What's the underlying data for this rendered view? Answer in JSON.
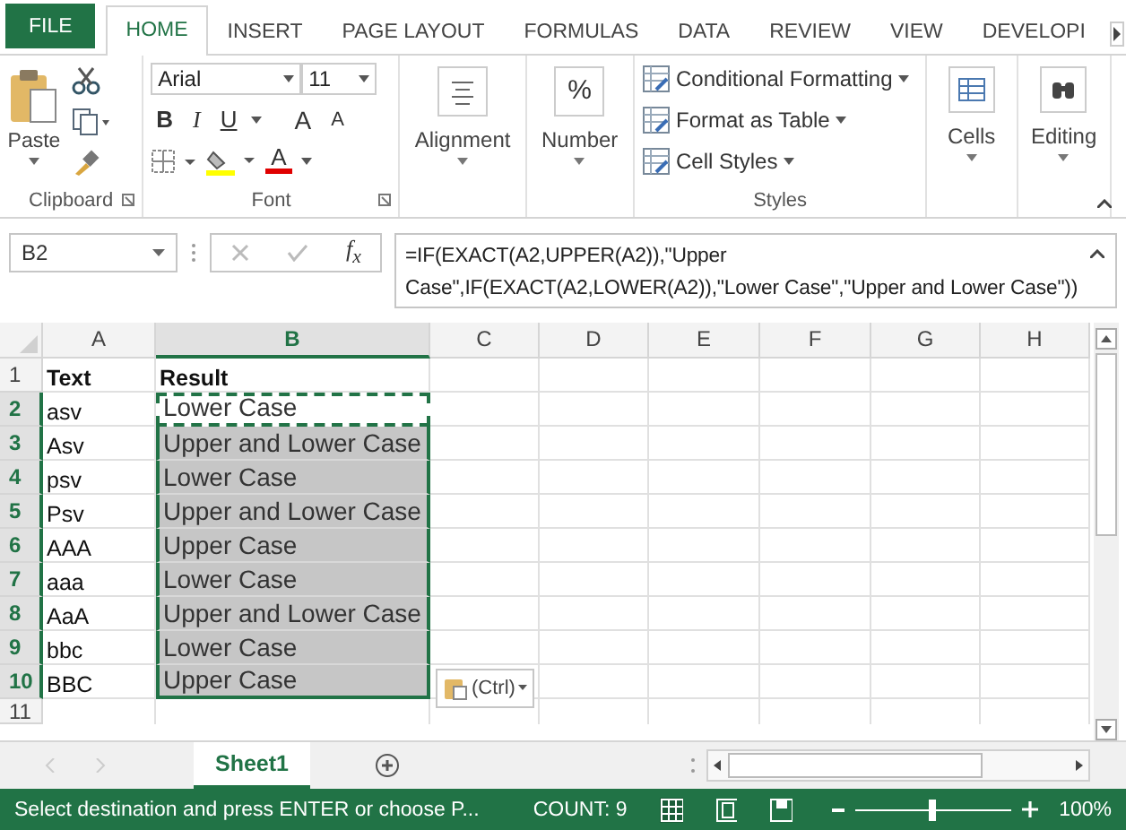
{
  "tabs": [
    {
      "label": "FILE",
      "kind": "file",
      "selected": false
    },
    {
      "label": "HOME",
      "kind": "tab",
      "selected": true
    },
    {
      "label": "INSERT",
      "kind": "tab",
      "selected": false
    },
    {
      "label": "PAGE LAYOUT",
      "kind": "tab",
      "selected": false
    },
    {
      "label": "FORMULAS",
      "kind": "tab",
      "selected": false
    },
    {
      "label": "DATA",
      "kind": "tab",
      "selected": false
    },
    {
      "label": "REVIEW",
      "kind": "tab",
      "selected": false
    },
    {
      "label": "VIEW",
      "kind": "tab",
      "selected": false
    },
    {
      "label": "DEVELOPI",
      "kind": "tab",
      "selected": false
    }
  ],
  "ribbon": {
    "clipboard": {
      "paste": "Paste",
      "label": "Clipboard"
    },
    "font": {
      "name": "Arial",
      "size": "11",
      "label": "Font",
      "bold": "B",
      "italic": "I",
      "underline": "U",
      "grow": "A",
      "shrink": "A",
      "font_color_letter": "A"
    },
    "alignment": {
      "label": "Alignment"
    },
    "number": {
      "symbol": "%",
      "label": "Number"
    },
    "styles": {
      "items": [
        "Conditional Formatting",
        "Format as Table",
        "Cell Styles"
      ],
      "label": "Styles"
    },
    "cells": {
      "label": "Cells"
    },
    "editing": {
      "label": "Editing"
    }
  },
  "formula_bar": {
    "name_box": "B2",
    "fx": "f$_{x}$",
    "formula": "=IF(EXACT(A2,UPPER(A2)),\"Upper Case\",IF(EXACT(A2,LOWER(A2)),\"Lower Case\",\"Upper and Lower Case\"))"
  },
  "columns": [
    {
      "label": "A",
      "selected": false
    },
    {
      "label": "B",
      "selected": true
    },
    {
      "label": "C",
      "selected": false
    },
    {
      "label": "D",
      "selected": false
    },
    {
      "label": "E",
      "selected": false
    },
    {
      "label": "F",
      "selected": false
    },
    {
      "label": "G",
      "selected": false
    },
    {
      "label": "H",
      "selected": false
    }
  ],
  "header_row": {
    "number": "1",
    "a": "Text",
    "b": "Result"
  },
  "rows": [
    {
      "number": "2",
      "a": "asv",
      "b": "Lower Case",
      "selected": true,
      "active": true
    },
    {
      "number": "3",
      "a": "Asv",
      "b": "Upper and Lower Case",
      "selected": true,
      "active": false
    },
    {
      "number": "4",
      "a": "psv",
      "b": "Lower Case",
      "selected": true,
      "active": false
    },
    {
      "number": "5",
      "a": "Psv",
      "b": "Upper and Lower Case",
      "selected": true,
      "active": false
    },
    {
      "number": "6",
      "a": "AAA",
      "b": "Upper Case",
      "selected": true,
      "active": false
    },
    {
      "number": "7",
      "a": "aaa",
      "b": "Lower Case",
      "selected": true,
      "active": false
    },
    {
      "number": "8",
      "a": "AaA",
      "b": "Upper and Lower Case",
      "selected": true,
      "active": false
    },
    {
      "number": "9",
      "a": "bbc",
      "b": "Lower Case",
      "selected": true,
      "active": false
    },
    {
      "number": "10",
      "a": "BBC",
      "b": "Upper Case",
      "selected": true,
      "active": false
    }
  ],
  "partial_row": {
    "number": "11"
  },
  "paste_options": "(Ctrl)",
  "sheet_tabs": [
    {
      "label": "Sheet1",
      "selected": true
    }
  ],
  "status_bar": {
    "message": "Select destination and press ENTER or choose P...",
    "count": "COUNT: 9",
    "zoom": "100%",
    "zoom_slider": {
      "level": 0.5
    }
  }
}
